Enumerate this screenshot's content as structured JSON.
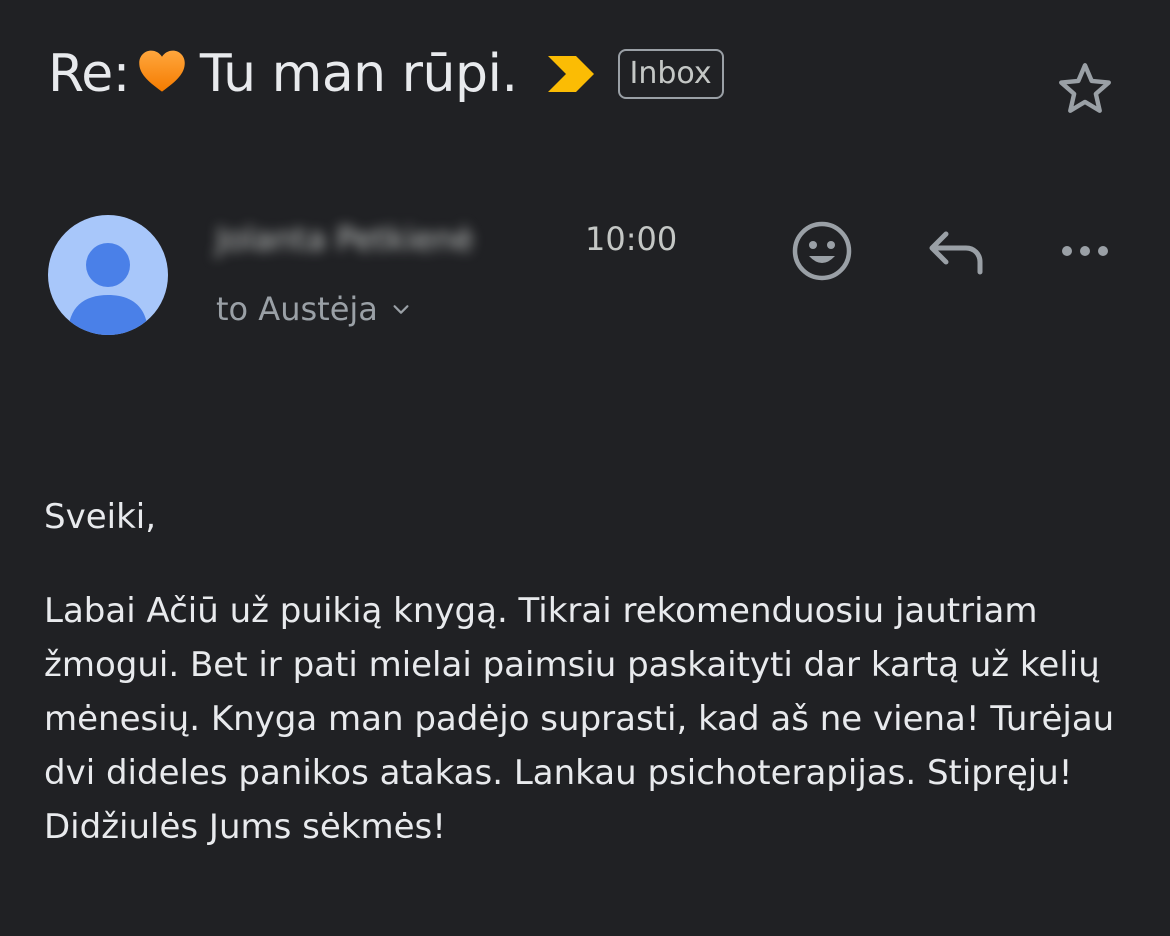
{
  "subject": {
    "prefix": "Re:",
    "emoji_icon": "orange-heart-icon",
    "title": "Tu man rūpi.",
    "label": "Inbox",
    "importance_color": "#fbbc04"
  },
  "message": {
    "sender_name": "Jolanta Petkienė",
    "time": "10:00",
    "recipient": "to Austėja",
    "avatar_color": "#a8c7fa",
    "avatar_figure_color": "#4a80e8"
  },
  "body": {
    "greeting": "Sveiki,",
    "paragraph": "Labai Ačiū už puikią knygą. Tikrai rekomenduosiu jautriam žmogui. Bet ir pati mielai paimsiu paskaityti dar kartą už kelių mėnesių. Knyga man padėjo suprasti, kad aš ne viena! Turėjau dvi dideles panikos atakas. Lankau psichoterapijas. Stipręju! Didžiulės Jums sėkmės!"
  },
  "icons": {
    "star": "star-icon",
    "emoji_reaction": "add-reaction-icon",
    "reply": "reply-icon",
    "more": "more-options-icon",
    "expand": "chevron-down-icon"
  }
}
